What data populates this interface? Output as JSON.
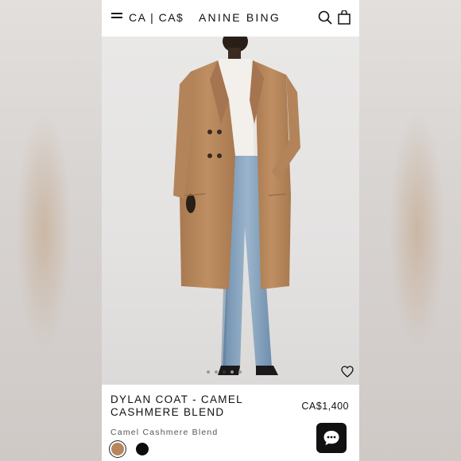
{
  "header": {
    "locale_label": "CA | CA$",
    "brand": "ANINE BING",
    "icons": [
      "menu-icon",
      "search-icon",
      "shopping-bag-icon"
    ]
  },
  "carousel": {
    "image_count": 5,
    "active_index": 2
  },
  "product": {
    "title": "DYLAN COAT - CAMEL CASHMERE BLEND",
    "price": "CA$1,400",
    "color_name": "Camel Cashmere Blend",
    "swatches": [
      {
        "name": "camel",
        "color": "#b8865d",
        "selected": true
      },
      {
        "name": "black",
        "color": "#0d0d0d",
        "selected": false
      }
    ]
  },
  "colors": {
    "background": "#ffffff",
    "text": "#111111",
    "coat": "#b98a60"
  }
}
